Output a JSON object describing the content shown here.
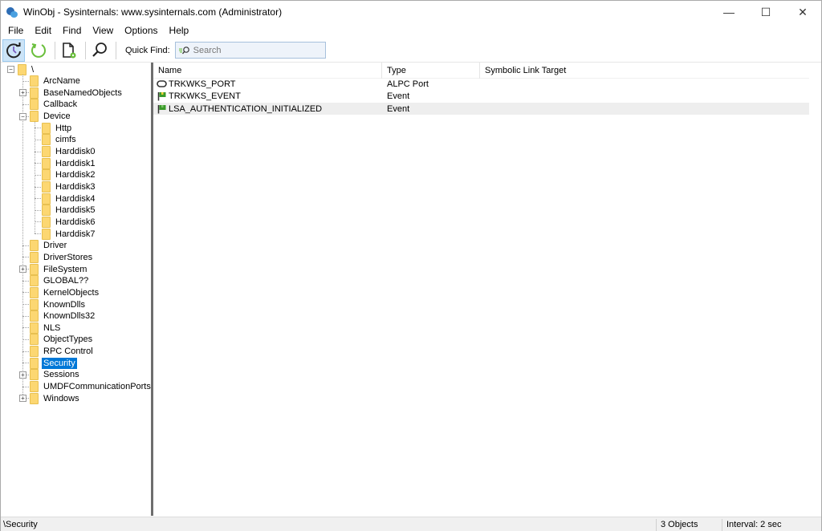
{
  "window": {
    "title": "WinObj - Sysinternals: www.sysinternals.com (Administrator)",
    "controls": {
      "minimize": "—",
      "maximize": "☐",
      "close": "✕"
    }
  },
  "menu": [
    "File",
    "Edit",
    "Find",
    "View",
    "Options",
    "Help"
  ],
  "toolbar": {
    "buttons": [
      {
        "name": "auto-refresh",
        "icon": "clock-refresh-icon",
        "active": true
      },
      {
        "name": "refresh",
        "icon": "refresh-icon",
        "active": false
      },
      {
        "name": "properties",
        "icon": "document-gear-icon",
        "active": false
      },
      {
        "name": "find",
        "icon": "search-icon",
        "active": false
      }
    ],
    "quick_find_label": "Quick Find:",
    "quick_find_placeholder": "Search",
    "quick_find_value": ""
  },
  "tree": {
    "root": "\\",
    "items": [
      {
        "label": "ArcName",
        "level": 1,
        "expandable": false
      },
      {
        "label": "BaseNamedObjects",
        "level": 1,
        "expandable": true,
        "expanded": false
      },
      {
        "label": "Callback",
        "level": 1,
        "expandable": false
      },
      {
        "label": "Device",
        "level": 1,
        "expandable": true,
        "expanded": true
      },
      {
        "label": "Http",
        "level": 2,
        "expandable": false
      },
      {
        "label": "cimfs",
        "level": 2,
        "expandable": false
      },
      {
        "label": "Harddisk0",
        "level": 2,
        "expandable": false
      },
      {
        "label": "Harddisk1",
        "level": 2,
        "expandable": false
      },
      {
        "label": "Harddisk2",
        "level": 2,
        "expandable": false
      },
      {
        "label": "Harddisk3",
        "level": 2,
        "expandable": false
      },
      {
        "label": "Harddisk4",
        "level": 2,
        "expandable": false
      },
      {
        "label": "Harddisk5",
        "level": 2,
        "expandable": false
      },
      {
        "label": "Harddisk6",
        "level": 2,
        "expandable": false
      },
      {
        "label": "Harddisk7",
        "level": 2,
        "expandable": false
      },
      {
        "label": "Driver",
        "level": 1,
        "expandable": false
      },
      {
        "label": "DriverStores",
        "level": 1,
        "expandable": false
      },
      {
        "label": "FileSystem",
        "level": 1,
        "expandable": true,
        "expanded": false
      },
      {
        "label": "GLOBAL??",
        "level": 1,
        "expandable": false
      },
      {
        "label": "KernelObjects",
        "level": 1,
        "expandable": false
      },
      {
        "label": "KnownDlls",
        "level": 1,
        "expandable": false
      },
      {
        "label": "KnownDlls32",
        "level": 1,
        "expandable": false
      },
      {
        "label": "NLS",
        "level": 1,
        "expandable": false
      },
      {
        "label": "ObjectTypes",
        "level": 1,
        "expandable": false
      },
      {
        "label": "RPC Control",
        "level": 1,
        "expandable": false
      },
      {
        "label": "Security",
        "level": 1,
        "expandable": false,
        "selected": true
      },
      {
        "label": "Sessions",
        "level": 1,
        "expandable": true,
        "expanded": false
      },
      {
        "label": "UMDFCommunicationPorts",
        "level": 1,
        "expandable": false
      },
      {
        "label": "Windows",
        "level": 1,
        "expandable": true,
        "expanded": false
      }
    ]
  },
  "list": {
    "columns": [
      "Name",
      "Type",
      "Symbolic Link Target"
    ],
    "rows": [
      {
        "name": "TRKWKS_PORT",
        "type": "ALPC Port",
        "link": "",
        "icon": "alpc-port-icon"
      },
      {
        "name": "TRKWKS_EVENT",
        "type": "Event",
        "link": "",
        "icon": "event-flag-icon"
      },
      {
        "name": "LSA_AUTHENTICATION_INITIALIZED",
        "type": "Event",
        "link": "",
        "icon": "event-flag-icon",
        "highlighted": true
      }
    ]
  },
  "status": {
    "path": "\\Security",
    "count": "3 Objects",
    "interval": "Interval: 2 sec"
  },
  "colors": {
    "selection": "#0078d7",
    "folder": "#fcd772",
    "active_button": "#cce4f7",
    "refresh_green": "#6abf3c"
  }
}
